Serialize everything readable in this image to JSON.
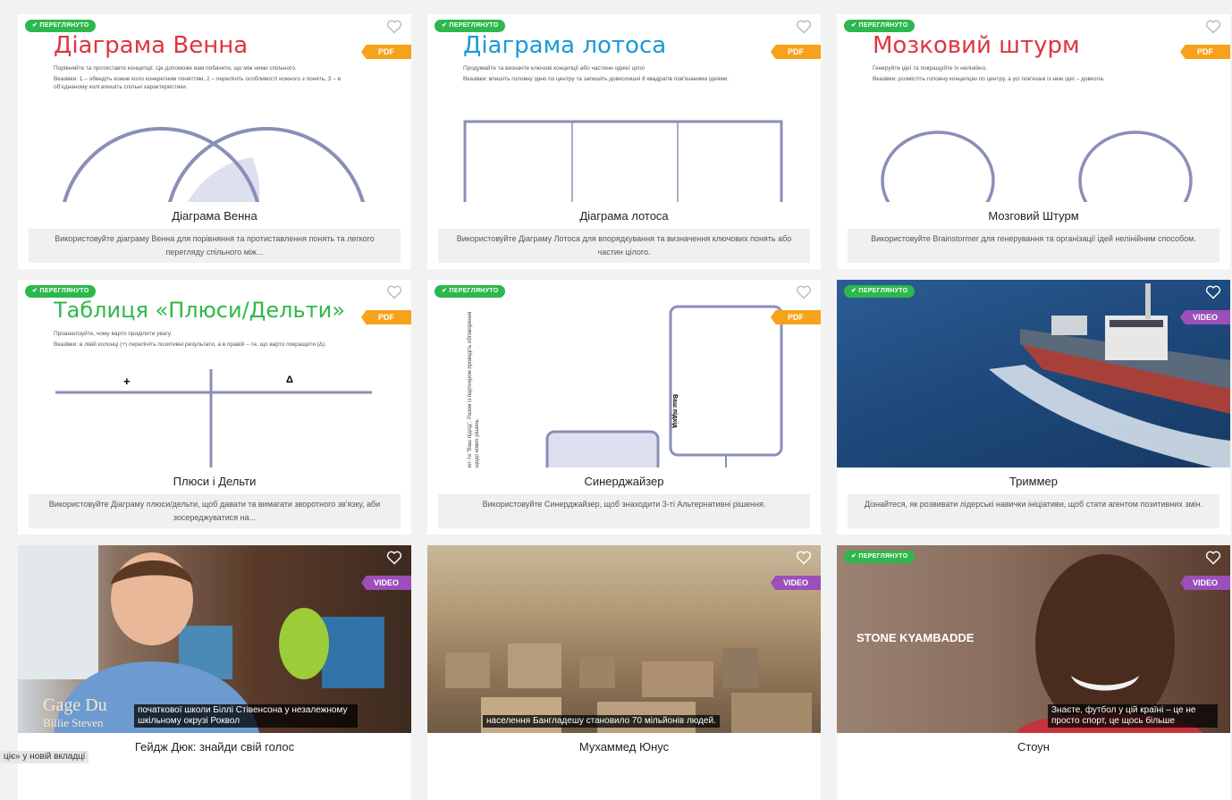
{
  "colors": {
    "viewed": "#2db84d",
    "pdf": "#f7a21b",
    "video": "#9b4fb8",
    "accent": "#8a8fb8"
  },
  "cards": [
    {
      "badge": "✔ ПЕРЕГЛЯНУТО",
      "tag": "PDF",
      "doc_title": "Діаграма Венна",
      "doc_sub": "Порівняйте та протиставте концепції. Це допоможе вам побачити, що між ними спільного.",
      "doc_hint": "Вказівки: 1 – обведіть кожне коло конкретним поняттям, 2 – перелічіть особливості кожного з понять, 3 – в об'єднаному колі впишіть спільні характеристики.",
      "title": "Діаграма Венна",
      "desc": "Використовуйте діаграму Венна для порівняння та протиставлення понять та легкого перегляду спільного між..."
    },
    {
      "badge": "✔ ПЕРЕГЛЯНУТО",
      "tag": "PDF",
      "doc_title": "Діаграма лотоса",
      "doc_sub": "Продумайте та визначте ключові концепції або частини однієї цілої",
      "doc_hint": "Вказівки: впишіть головну ідею по центру та запишіть довколишні 8 квадратів пов'язаними ідеями.",
      "title": "Діаграма лотоса",
      "desc": "Використовуйте Діаграму Лотоса для впорядкування та визначення ключових понять або частин цілого."
    },
    {
      "badge": "✔ ПЕРЕГЛЯНУТО",
      "tag": "PDF",
      "doc_title": "Мозковий штурм",
      "doc_sub": "Генеруйте ідеї та покращуйте їх нелінійно.",
      "doc_hint": "Вказівки: розмістіть головну концепцію по центру, а усі пов'язані із нею ідеї – довкола.",
      "title": "Мозговий Штурм",
      "desc": "Використовуйте Brainstormer для генерування та організації ідей нелінійним способом."
    },
    {
      "badge": "✔ ПЕРЕГЛЯНУТО",
      "tag": "PDF",
      "doc_title": "Таблиця «Плюси/Дельти»",
      "doc_sub": "Проаналізуйте, чому варто приділити увагу.",
      "doc_hint": "Вказівки: в лівій колонці (+) перелічіть позитивні результати, а в правій – те, що варто покращити (Δ).",
      "plus": "+",
      "delta": "Δ",
      "title": "Плюси і Дельти",
      "desc": "Використовуйте Діаграму плюси/дельти, щоб давати та вимагати зворотного зв'язку, аби зосереджуватися на..."
    },
    {
      "badge": "✔ ПЕРЕГЛЯНУТО",
      "tag": "PDF",
      "rot_text": "Ваш підхід",
      "side_text": "ют-та \"Ваш підхід\". Разом із партнером проведіть обговорення щодо нових рішень",
      "title": "Синерджайзер",
      "desc": "Використовуйте Синерджайзер, щоб знаходити 3-ті Альтернативні рішення."
    },
    {
      "badge": "✔ ПЕРЕГЛЯНУТО",
      "tag": "VIDEO",
      "title": "Триммер",
      "desc": "Дізнайтеся, як розвивати лідерські навички ініціативи, щоб стати агентом позитивних змін."
    },
    {
      "tag": "VIDEO",
      "name_line1": "Gage Du",
      "name_line2": "Billie Steven",
      "caption": "початкової школи Біллі Стівенсона у незалежному шкільному окрузі Роквол",
      "title": "Гейдж Дюк: знайди свій голос",
      "desc": ""
    },
    {
      "tag": "VIDEO",
      "caption": "населення Бангладешу становило 70 мільйонів людей.",
      "title": "Мухаммед Юнус",
      "desc": ""
    },
    {
      "badge": "✔ ПЕРЕГЛЯНУТО",
      "tag": "VIDEO",
      "name_line1": "STONE KYAMBADDE",
      "caption": "Знаєте, футбол у цій країні – це не просто спорт, це щось більше",
      "title": "Стоун",
      "desc": ""
    }
  ],
  "statusbar": "ціє» у новій вкладці"
}
